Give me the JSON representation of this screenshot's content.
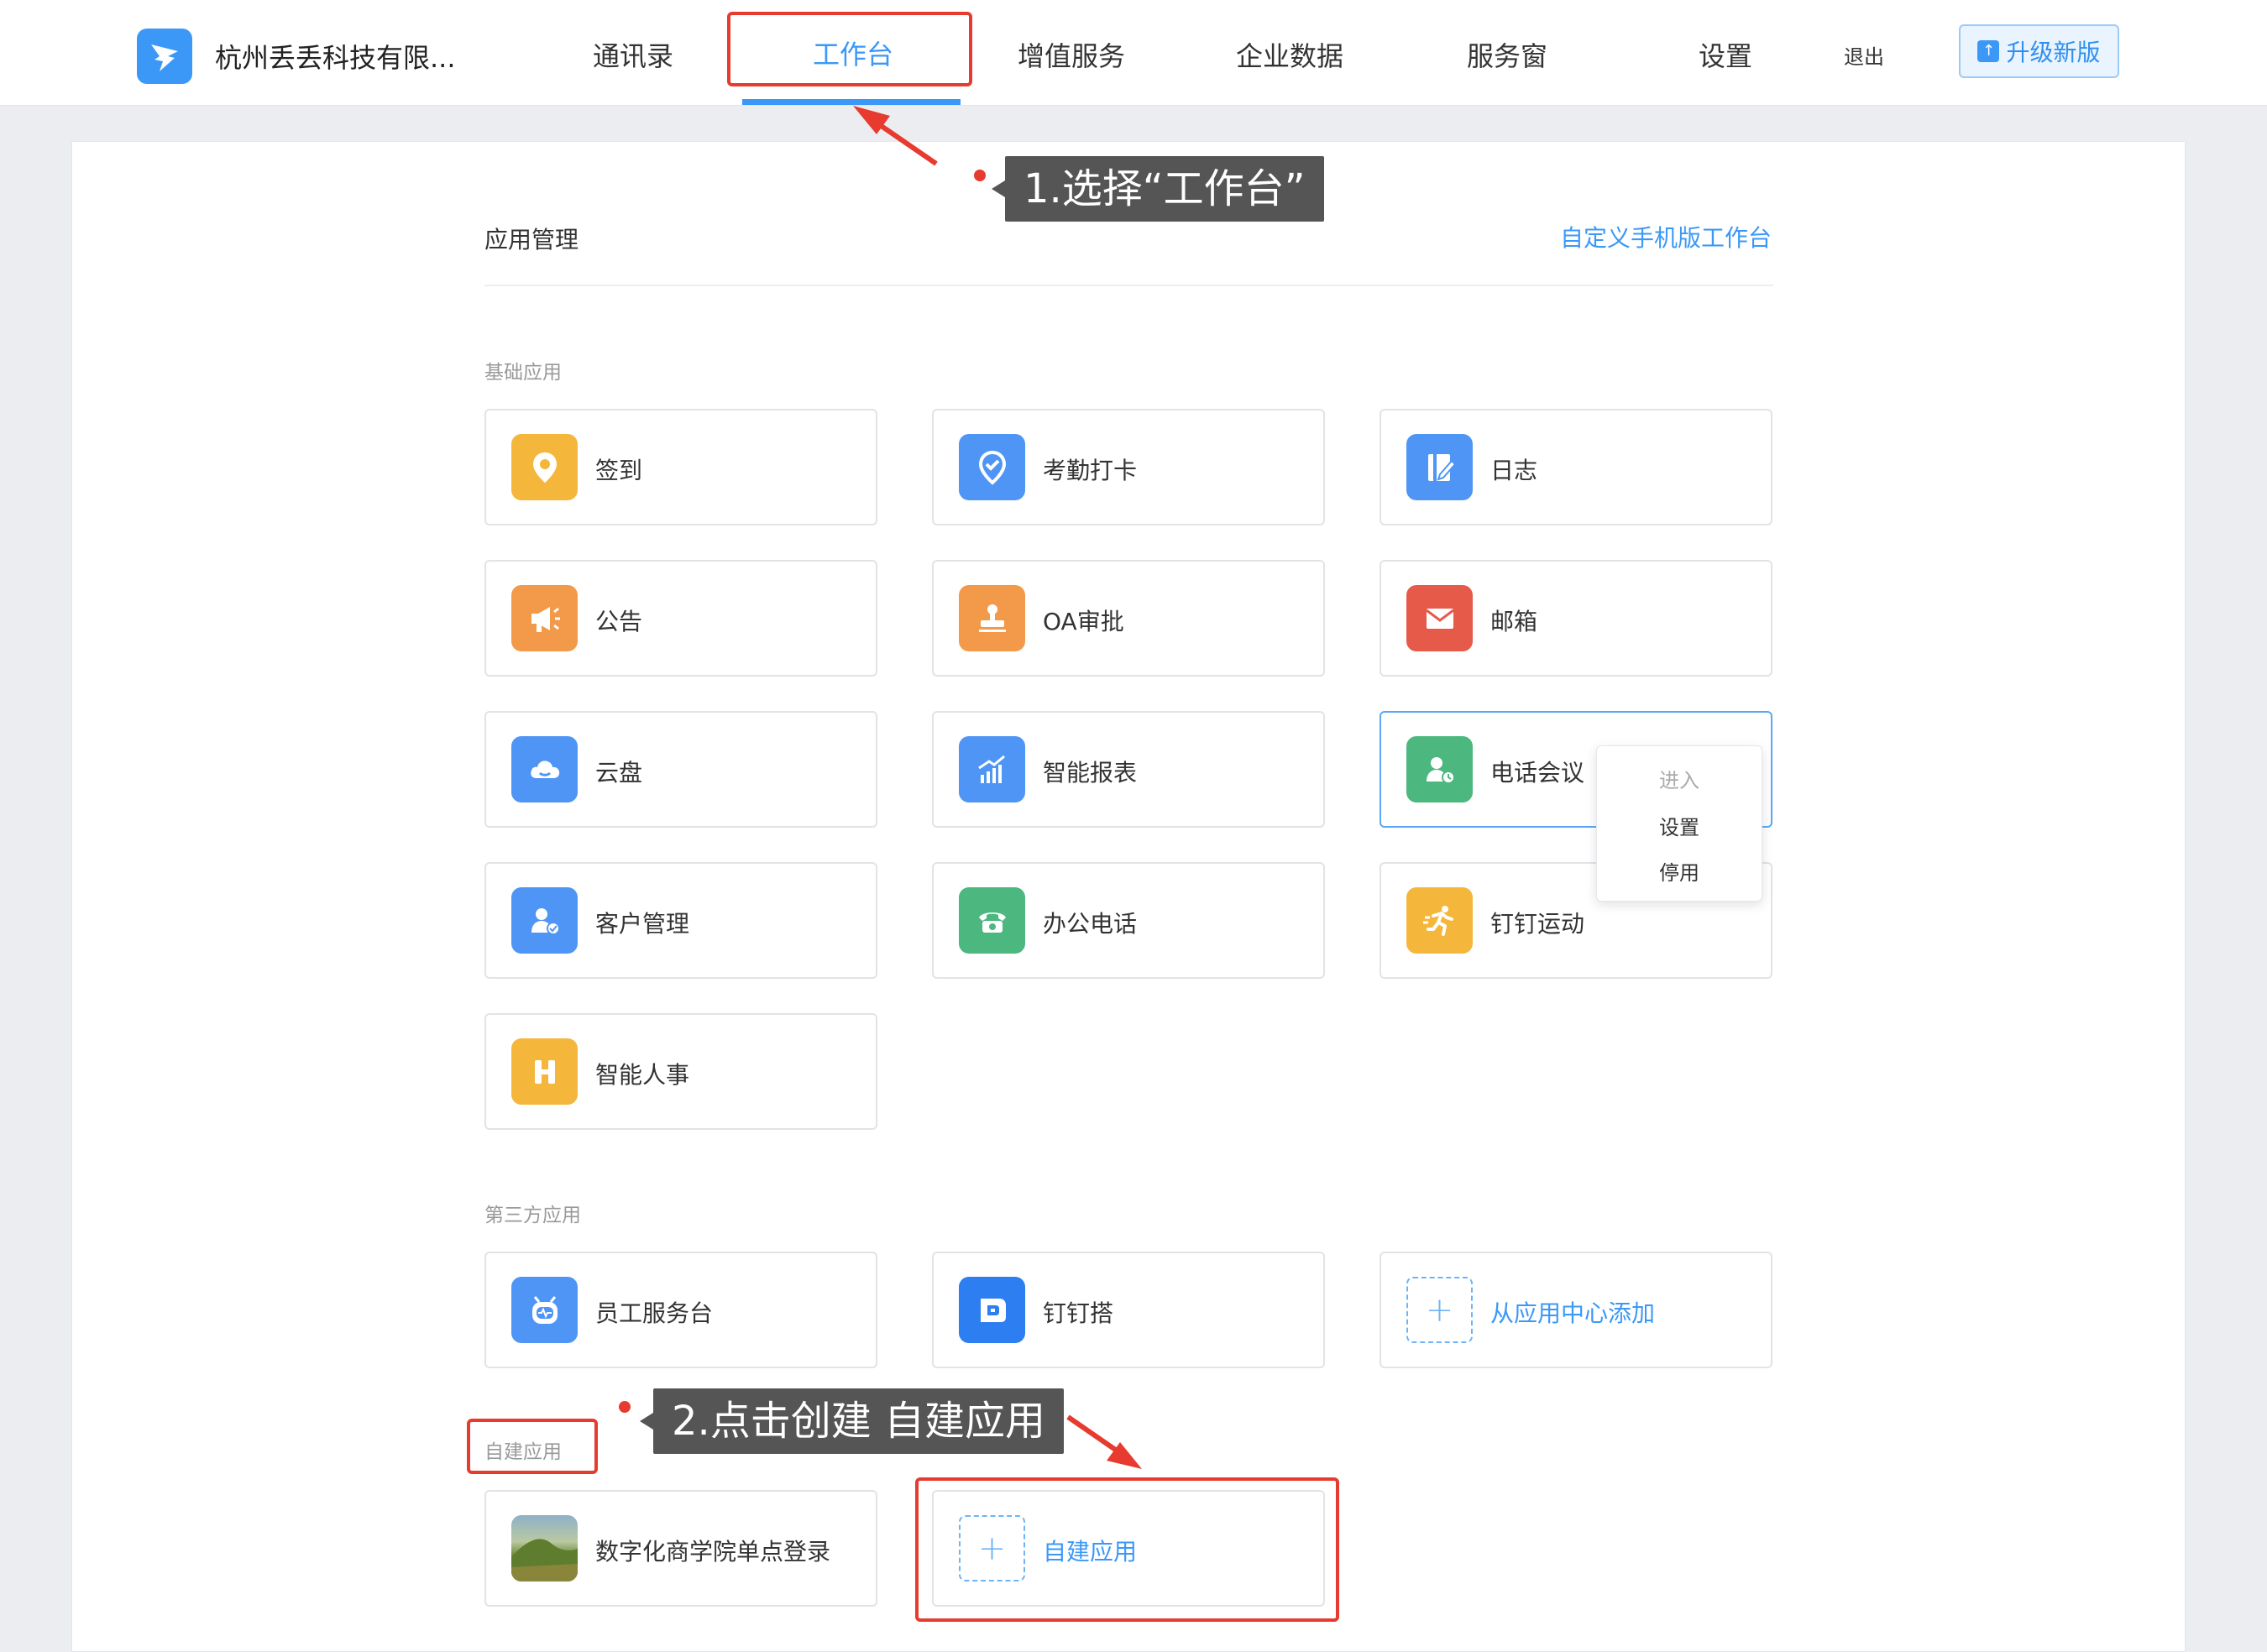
{
  "header": {
    "company": "杭州丢丢科技有限...",
    "nav": [
      "通讯录",
      "工作台",
      "增值服务",
      "企业数据",
      "服务窗",
      "设置"
    ],
    "logout": "退出",
    "upgrade": "升级新版"
  },
  "main": {
    "title": "应用管理",
    "custom_link": "自定义手机版工作台",
    "groups": {
      "basic": "基础应用",
      "third_party": "第三方应用",
      "self_built": "自建应用"
    },
    "basic_apps": [
      "签到",
      "考勤打卡",
      "日志",
      "公告",
      "OA审批",
      "邮箱",
      "云盘",
      "智能报表",
      "电话会议",
      "客户管理",
      "办公电话",
      "钉钉运动",
      "智能人事"
    ],
    "third_party_apps": [
      "员工服务台",
      "钉钉搭",
      "从应用中心添加"
    ],
    "self_built_apps": [
      "数字化商学院单点登录",
      "自建应用"
    ],
    "context_menu": [
      "进入",
      "设置",
      "停用"
    ]
  },
  "annotations": {
    "step1": "1.选择“工作台”",
    "step2": "2.点击创建 自建应用"
  },
  "colors": {
    "accent": "#3b98f7",
    "annotation_red": "#e63b2e",
    "yellow": "#f5b73b",
    "orange": "#f29a4a",
    "blue": "#4f95f5",
    "red": "#e65a4a",
    "green": "#4cb87f"
  },
  "icons": [
    "location-pin-icon",
    "check-pin-icon",
    "journal-icon",
    "megaphone-icon",
    "stamp-icon",
    "mail-icon",
    "cloud-icon",
    "chart-icon",
    "phone-meeting-icon",
    "customer-icon",
    "telephone-icon",
    "running-icon",
    "h-icon",
    "robot-icon",
    "dingda-icon",
    "plus-icon",
    "photo-thumbnail-icon"
  ]
}
